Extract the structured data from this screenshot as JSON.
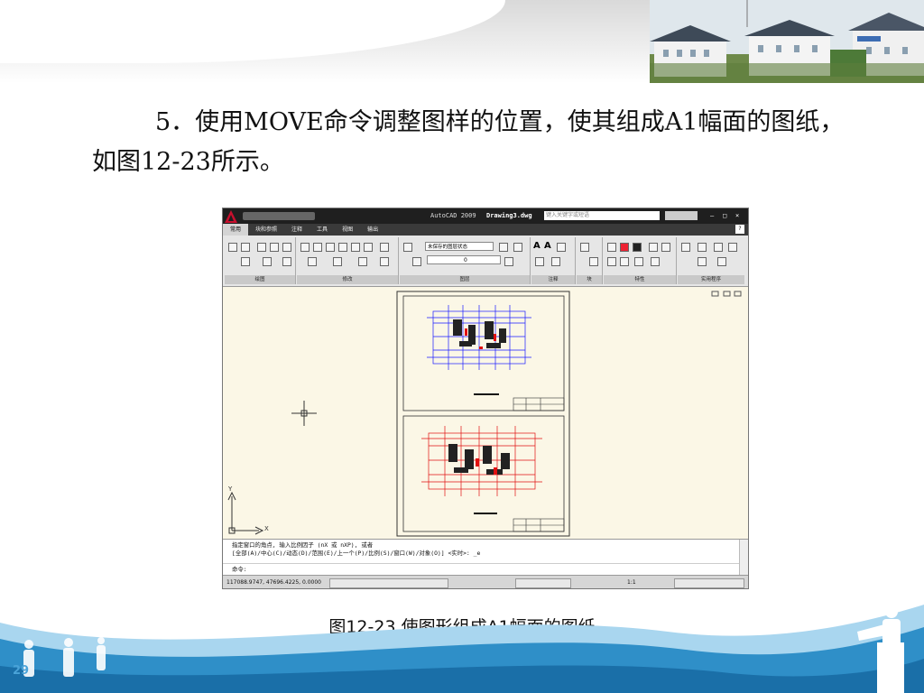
{
  "slide": {
    "paragraph": "5．使用MOVE命令调整图样的位置，使其组成A1幅面的图纸，如图12-23所示。",
    "caption": "图12-23  使图形组成A1幅面的图纸",
    "page_number": "29"
  },
  "autocad": {
    "title": "AutoCAD 2009",
    "document": "Drawing3.dwg",
    "search_placeholder": "键入关键字或短语",
    "tabs": [
      "常用",
      "块和参照",
      "注释",
      "工具",
      "视图",
      "输出"
    ],
    "panels": [
      "绘图",
      "修改",
      "图层",
      "注释",
      "块",
      "特性",
      "实用程序"
    ],
    "layer_state": "未保存的图层状态",
    "current_layer": "0",
    "axis_y": "Y",
    "axis_x": "X",
    "command_lines": [
      "指定窗口的角点, 输入比例因子 (nX 或 nXP), 或者",
      "[全部(A)/中心(C)/动态(D)/范围(E)/上一个(P)/比例(S)/窗口(W)/对象(O)] <实时>: _e"
    ],
    "prompt": "命令:",
    "coordinates": "117088.9747,  47696.4225,  0.0000",
    "scale": "1:1"
  },
  "colors": {
    "canvas": "#fbf7e6",
    "footer_blue": "#2f8fc8",
    "drawing_blue": "#1a1aff",
    "drawing_red": "#e01010"
  }
}
